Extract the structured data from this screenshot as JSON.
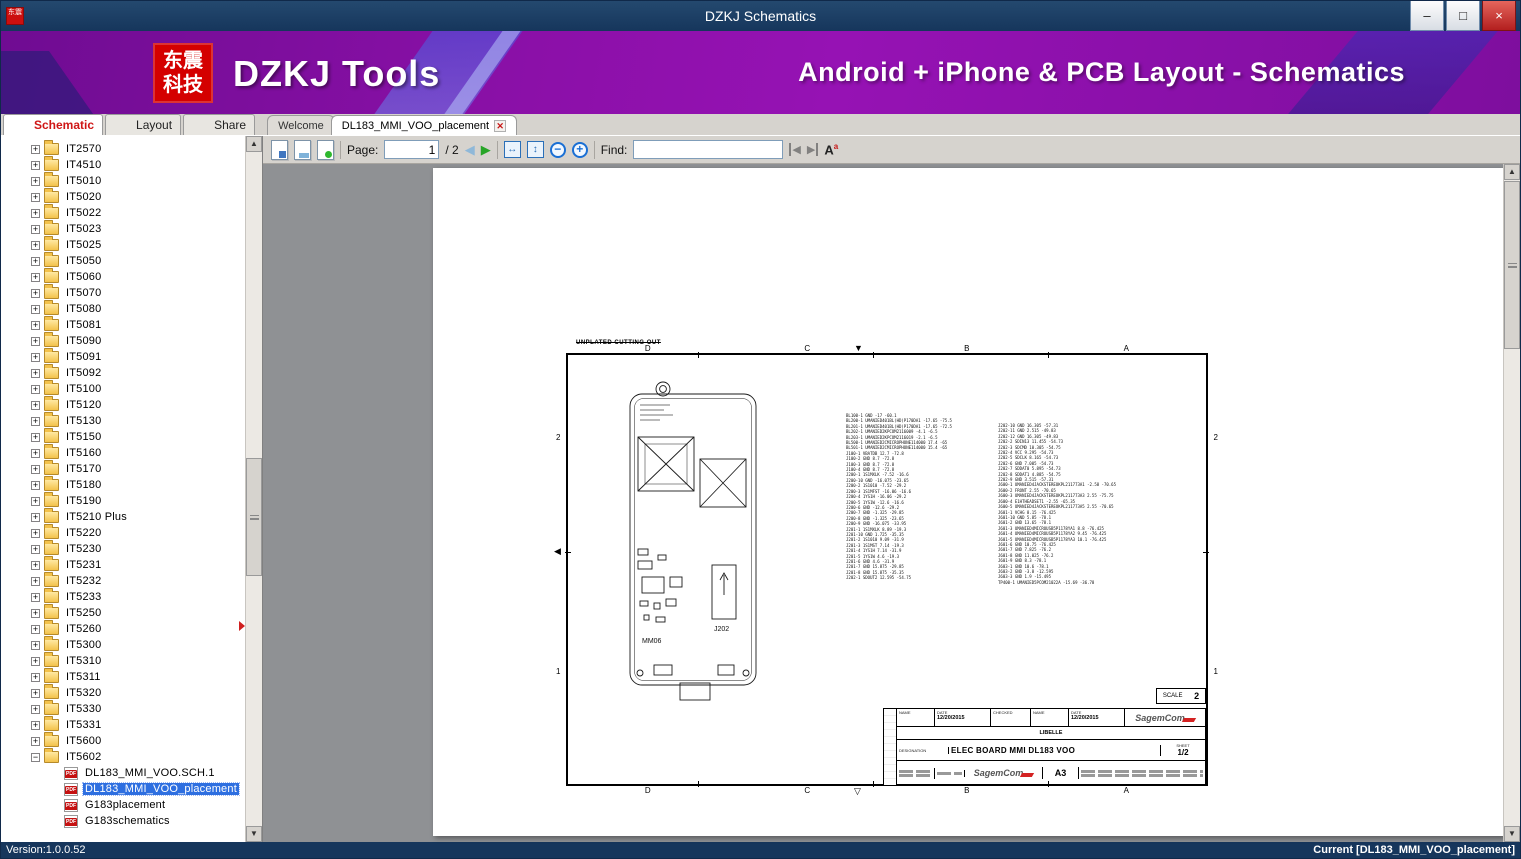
{
  "window": {
    "title": "DZKJ Schematics",
    "minimize": "–",
    "maximize": "□",
    "close": "×"
  },
  "banner": {
    "logo_line1": "东震",
    "logo_line2": "科技",
    "app_name": "DZKJ Tools",
    "tagline": "Android + iPhone & PCB Layout - Schematics",
    "accent_purple": "#8b10a8",
    "accent_blue": "#2a3fd0"
  },
  "tabs": {
    "main": [
      {
        "label": "Schematic",
        "icon": "pdf",
        "active": true
      },
      {
        "label": "Layout",
        "icon": "pads"
      },
      {
        "label": "Share",
        "icon": "share"
      }
    ],
    "documents": [
      {
        "label": "Welcome"
      },
      {
        "label": "DL183_MMI_VOO_placement",
        "active": true,
        "closable": true
      }
    ]
  },
  "sidebar": {
    "items": [
      {
        "label": "IT2570",
        "type": "folder"
      },
      {
        "label": "IT4510",
        "type": "folder"
      },
      {
        "label": "IT5010",
        "type": "folder"
      },
      {
        "label": "IT5020",
        "type": "folder"
      },
      {
        "label": "IT5022",
        "type": "folder"
      },
      {
        "label": "IT5023",
        "type": "folder"
      },
      {
        "label": "IT5025",
        "type": "folder"
      },
      {
        "label": "IT5050",
        "type": "folder"
      },
      {
        "label": "IT5060",
        "type": "folder"
      },
      {
        "label": "IT5070",
        "type": "folder"
      },
      {
        "label": "IT5080",
        "type": "folder"
      },
      {
        "label": "IT5081",
        "type": "folder"
      },
      {
        "label": "IT5090",
        "type": "folder"
      },
      {
        "label": "IT5091",
        "type": "folder"
      },
      {
        "label": "IT5092",
        "type": "folder"
      },
      {
        "label": "IT5100",
        "type": "folder"
      },
      {
        "label": "IT5120",
        "type": "folder"
      },
      {
        "label": "IT5130",
        "type": "folder"
      },
      {
        "label": "IT5150",
        "type": "folder"
      },
      {
        "label": "IT5160",
        "type": "folder"
      },
      {
        "label": "IT5170",
        "type": "folder"
      },
      {
        "label": "IT5180",
        "type": "folder"
      },
      {
        "label": "IT5190",
        "type": "folder"
      },
      {
        "label": "IT5210 Plus",
        "type": "folder"
      },
      {
        "label": "IT5220",
        "type": "folder"
      },
      {
        "label": "IT5230",
        "type": "folder"
      },
      {
        "label": "IT5231",
        "type": "folder"
      },
      {
        "label": "IT5232",
        "type": "folder"
      },
      {
        "label": "IT5233",
        "type": "folder"
      },
      {
        "label": "IT5250",
        "type": "folder"
      },
      {
        "label": "IT5260",
        "type": "folder"
      },
      {
        "label": "IT5300",
        "type": "folder"
      },
      {
        "label": "IT5310",
        "type": "folder"
      },
      {
        "label": "IT5311",
        "type": "folder"
      },
      {
        "label": "IT5320",
        "type": "folder"
      },
      {
        "label": "IT5330",
        "type": "folder"
      },
      {
        "label": "IT5331",
        "type": "folder"
      },
      {
        "label": "IT5600",
        "type": "folder"
      },
      {
        "label": "IT5602",
        "type": "folder",
        "expanded": true
      },
      {
        "label": "DL183_MMI_VOO.SCH.1",
        "type": "pdf"
      },
      {
        "label": "DL183_MMI_VOO_placement",
        "type": "pdf",
        "selected": true
      },
      {
        "label": "G183placement",
        "type": "pdf"
      },
      {
        "label": "G183schematics",
        "type": "pdf"
      }
    ]
  },
  "toolbar": {
    "page_label": "Page:",
    "page_value": "1",
    "page_total": "/ 2",
    "find_label": "Find:",
    "find_value": "",
    "zoom_out": "−",
    "zoom_in": "+",
    "prev": "◀",
    "next": "▶",
    "fit_width": "↔",
    "fit_page": "↕"
  },
  "drawing": {
    "note": "UNPLATED CUTTING OUT",
    "grid_letters": [
      "D",
      "C",
      "B",
      "A"
    ],
    "row_numbers": [
      "2",
      "1"
    ],
    "board": {
      "j202": "J202",
      "mm06": "MM06"
    },
    "placement_list_a": [
      "BL100-1 GND -17 -60.1",
      "BL200-1 UMANIED401BL(HD)P170DA1 -17.65 -75.5",
      "BL201-1 UMANIED401BL(HD)P170DA1 -17.65 -72.5",
      "BL202-1 UMANIED2KPCOM2116009 -4.1 -6.5",
      "BL203-1 UMANIED2KPCOM2116019 -2.1 -6.5",
      "BL500-1 UMANIED2CMICROPHONE114000 17.4 -65",
      "BL501-1 UMANIED2CMICROPHONE114000 15.4 -65",
      "J100-1 VBATDB 12.7 -72.8",
      "J100-2 GND 8.7 -72.8",
      "J100-3 GND 8.7 -72.8",
      "J100-4 GND 8.7 -72.8",
      "J200-1 1S1MXLK -7.52 -16.6",
      "J200-10 GND -16.075 -23.65",
      "J200-2 1S1010 -7.52 -29.2",
      "J200-3 1S1MFST -16.06 -16.6",
      "J200-4 1YS1H -16.06 -29.2",
      "J200-5 1YS1W -12.6 -16.6",
      "J200-6 GND -12.6 -29.2",
      "J200-7 GND -1.325 -29.85",
      "J200-8 GND -1.325 -23.65",
      "J200-9 GND -16.075 -33.95",
      "J201-1 1S1MXLK 8.89 -19.3",
      "J201-10 GND 1.725 -35.35",
      "J201-2 1S1010 9.09 -31.9",
      "J201-3 1S1MST 7.14 -19.3",
      "J201-4 1YS1H 7.14 -31.9",
      "J201-5 1YS1W 4.6 -19.3",
      "J201-6 GND 4.6 -31.9",
      "J201-7 GND 15.875 -29.85",
      "J201-8 GND 15.875 -35.35",
      "J202-1 SDOUT2 12.595 -54.75"
    ],
    "placement_list_b": [
      "J202-10 GND 16.305 -57.31",
      "J202-11 GND 2.515 -49.83",
      "J202-12 GND 16.305 -49.83",
      "J202-2 SDIN13 11.455 -54.73",
      "J202-3 SDCMD 10.305 -54.75",
      "J202-4 VCC 9.295 -54.73",
      "J202-5 SDCLK 8.165 -54.73",
      "J202-6 GND 7.005 -54.73",
      "J202-7 SDDAT0 5.895 -54.73",
      "J202-8 SDDAT1 4.885 -54.75",
      "J202-9 GND 3.515 -57.31",
      "J600-1 UMANIED4JACKSTEREOKPL211773A1 -2.58 -70.65",
      "J600-2 FRONT 2.55 -70.65",
      "J600-3 UMANIED4JACKSTEREOKPL211773A3 2.55 -75.75",
      "J600-4 E1HTHEADSET1 -2.55 -65.35",
      "J600-5 UMANIED4JACKSTEREOKPL211773A5 2.55 -70.65",
      "J601-1 VCHG 8.15 -76.425",
      "J601-10 GND 5.85 -78.1",
      "J601-2 GND 13.65 -78.1",
      "J601-3 UMANIED4MICROUSB5P1178YA1 8.8 -76.425",
      "J601-4 UMANIED4MICROUSB5P1178YA2 9.45 -76.425",
      "J601-5 UMANIED4MICROUSB5P1178YA3 10.1 -76.425",
      "J601-6 GND 10.75 -76.425",
      "J601-7 GND 7.825 -76.2",
      "J601-8 GND 11.025 -76.2",
      "J601-9 GND 8.3 -78.1",
      "J603-1 GND 10.6 -78.1",
      "J603-2 GND -3.8 -12.595",
      "J603-3 GND 1.9 -15.495",
      "TP400-1 UMANIED5PCOM21022A -15.69 -36.78"
    ],
    "title_block": {
      "name_label": "NAME",
      "date_label": "DATE",
      "checked_label": "CHECKED",
      "date1": "12/20/2015",
      "date2": "12/20/2015",
      "libelle": "LIBELLE",
      "designation_label": "DESIGNATION",
      "designation": "ELEC BOARD MMI DL183 VOO",
      "sheet_label": "SHEET",
      "sheet": "1/2",
      "size": "A3",
      "scale_label": "SCALE",
      "scale": "2",
      "company": "SagemCom"
    }
  },
  "status_bar": {
    "version": "Version:1.0.0.52",
    "current": "Current [DL183_MMI_VOO_placement]"
  }
}
